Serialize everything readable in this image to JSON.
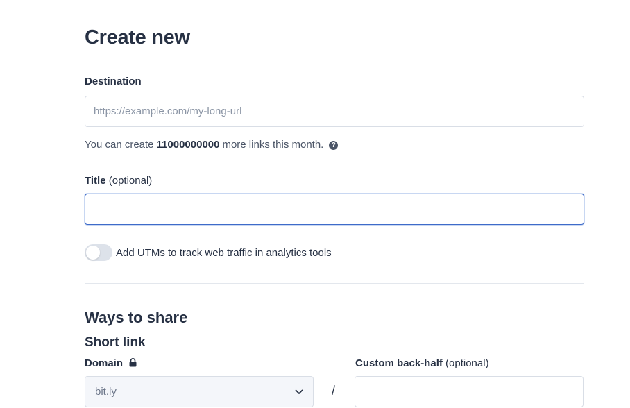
{
  "page": {
    "title": "Create new"
  },
  "destination": {
    "label": "Destination",
    "placeholder": "https://example.com/my-long-url",
    "value": ""
  },
  "quota": {
    "prefix": "You can create",
    "count": "11000000000",
    "suffix": "more links this month.",
    "help_icon": "question-circle-icon",
    "help_glyph": "?"
  },
  "title_field": {
    "label": "Title",
    "optional": "(optional)",
    "value": ""
  },
  "utm": {
    "label": "Add UTMs to track web traffic in analytics tools",
    "enabled": false
  },
  "share": {
    "title": "Ways to share",
    "short_link": {
      "title": "Short link",
      "domain_label": "Domain",
      "domain_lock_icon": "lock-icon",
      "domain_value": "bit.ly",
      "separator": "/",
      "backhalf_label": "Custom back-half",
      "backhalf_optional": "(optional)",
      "backhalf_value": ""
    }
  },
  "colors": {
    "text": "#273144",
    "focus_border": "#3f6bc9",
    "border": "#d9dee6",
    "toggle_off": "#dde2ea"
  }
}
